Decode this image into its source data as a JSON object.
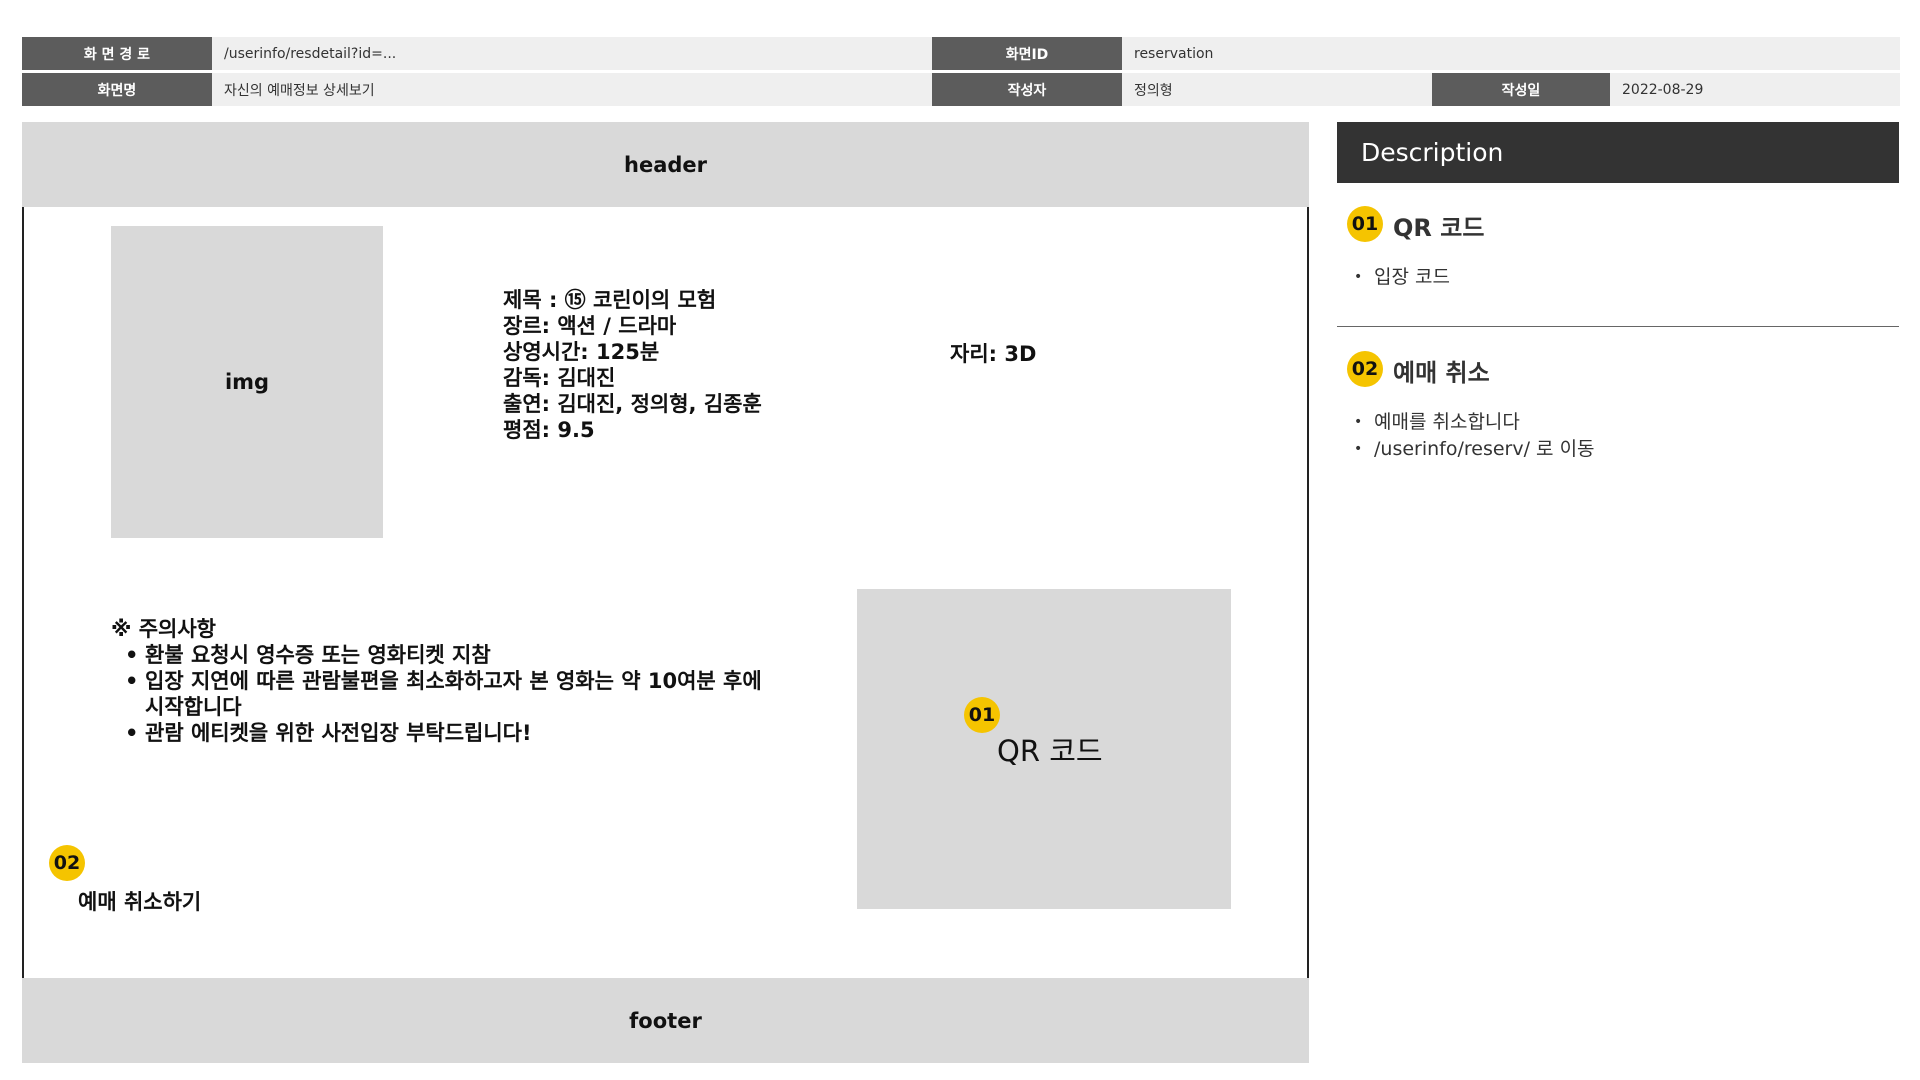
{
  "meta": {
    "path_label": "화 면 경 로",
    "path_value": "/userinfo/resdetail?id=...",
    "screen_id_label": "화면ID",
    "screen_id_value": "reservation",
    "screen_name_label": "화면명",
    "screen_name_value": "자신의 예매정보 상세보기",
    "author_label": "작성자",
    "author_value": "정의형",
    "date_label": "작성일",
    "date_value": "2022-08-29"
  },
  "wireframe": {
    "header": "header",
    "footer": "footer",
    "img": "img",
    "info": [
      "제목 : ⑮ 코린이의 모험",
      "장르: 액션 / 드라마",
      "상영시간: 125분",
      "감독: 김대진",
      "출연: 김대진, 정의형, 김종훈",
      "평점: 9.5"
    ],
    "seat": "자리: 3D",
    "notice_title": "※ 주의사항",
    "notice_items": [
      "환불 요청시 영수증 또는 영화티켓 지참",
      "입장 지연에 따른 관람불편을 최소화하고자 본 영화는 약 10여분 후에 시작합니다",
      "관람 에티켓을 위한 사전입장 부탁드립니다!"
    ],
    "qr_badge": "01",
    "qr_label": "QR 코드",
    "cancel_badge": "02",
    "cancel_label": "예매 취소하기"
  },
  "description": {
    "title": "Description",
    "sections": [
      {
        "badge": "01",
        "title": "QR 코드",
        "items": [
          "입장 코드"
        ]
      },
      {
        "badge": "02",
        "title": "예매 취소",
        "items": [
          "예매를 취소합니다",
          "/userinfo/reserv/ 로 이동"
        ]
      }
    ]
  },
  "colors": {
    "label_bg": "#5c5c5c",
    "value_bg": "#efefef",
    "wire_gray": "#d9d9d9",
    "desc_header_bg": "#333333",
    "badge_yellow": "#f5c400"
  }
}
